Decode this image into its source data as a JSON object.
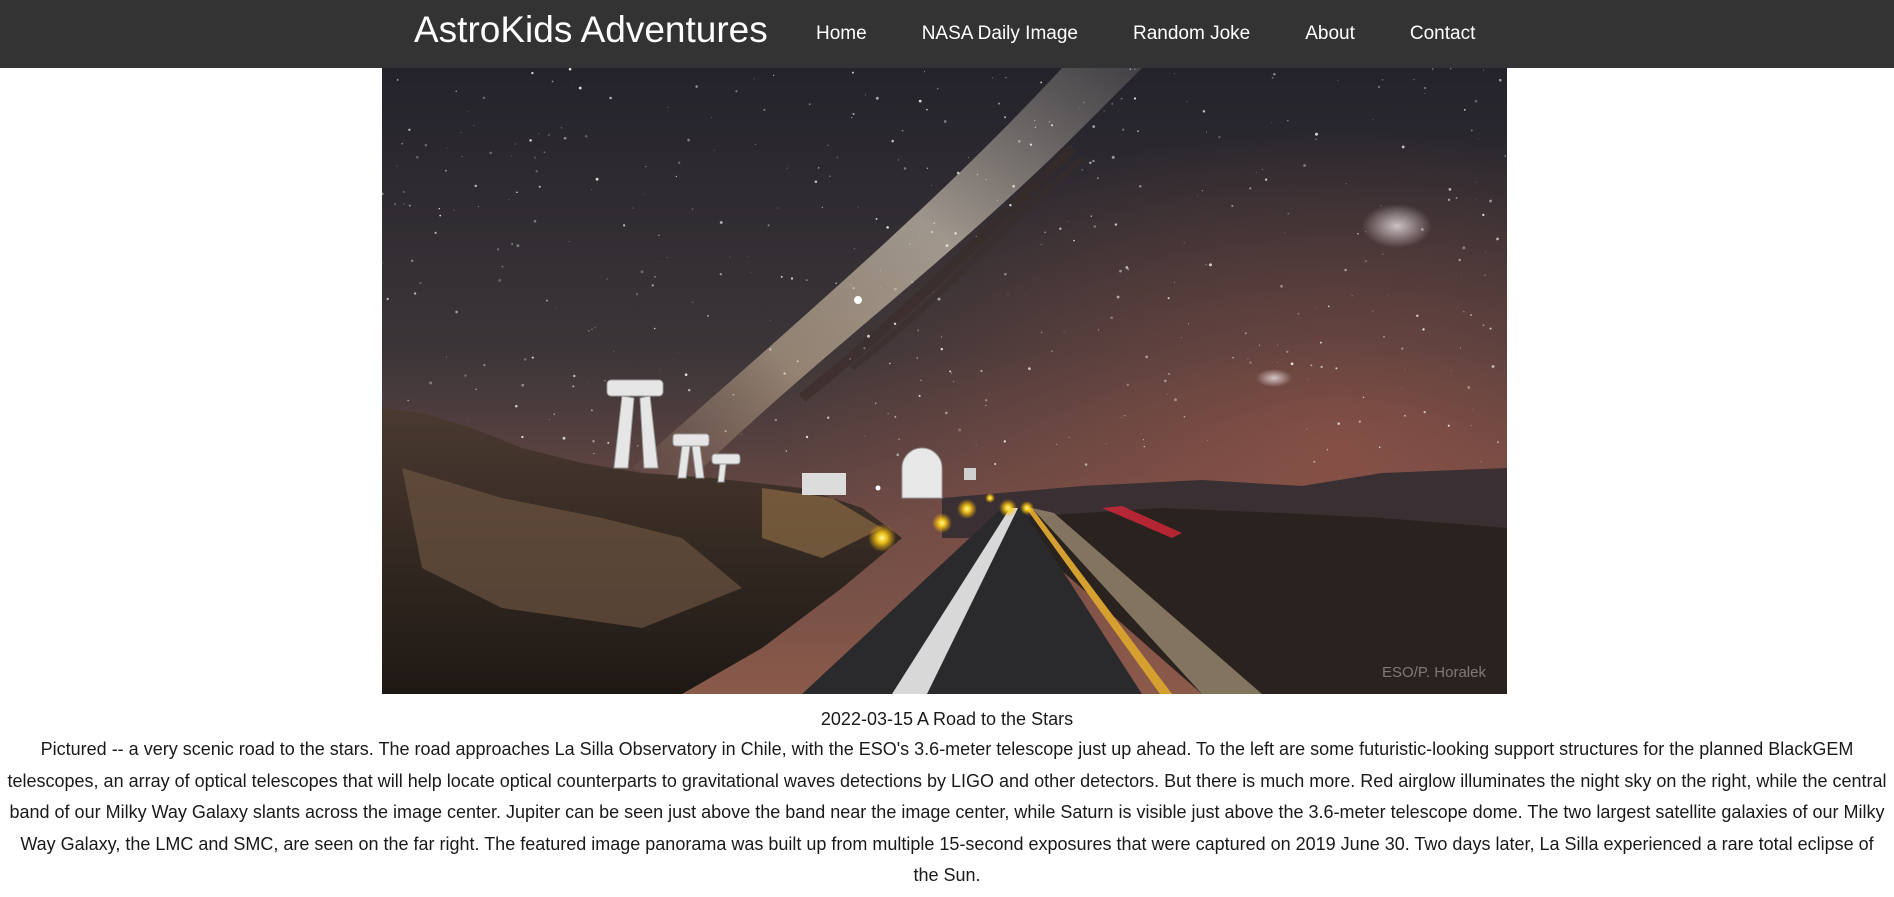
{
  "site": {
    "brand": "AstroKids Adventures"
  },
  "nav": {
    "items": [
      {
        "label": "Home"
      },
      {
        "label": "NASA Daily Image"
      },
      {
        "label": "Random Joke"
      },
      {
        "label": "About"
      },
      {
        "label": "Contact"
      }
    ]
  },
  "apod": {
    "title": "2022-03-15 A Road to the Stars",
    "explanation": "Pictured -- a very scenic road to the stars. The road approaches La Silla Observatory in Chile, with the ESO's 3.6-meter telescope just up ahead. To the left are some futuristic-looking support structures for the planned BlackGEM telescopes, an array of optical telescopes that will help locate optical counterparts to gravitational waves detections by LIGO and other detectors. But there is much more. Red airglow illuminates the night sky on the right, while the central band of our Milky Way Galaxy slants across the image center. Jupiter can be seen just above the band near the image center, while Saturn is visible just above the 3.6-meter telescope dome. The two largest satellite galaxies of our Milky Way Galaxy, the LMC and SMC, are seen on the far right. The featured image panorama was built up from multiple 15-second exposures that were captured on 2019 June 30. Two days later, La Silla experienced a rare total eclipse of the Sun.",
    "image_credit": "ESO/P. Horalek"
  }
}
